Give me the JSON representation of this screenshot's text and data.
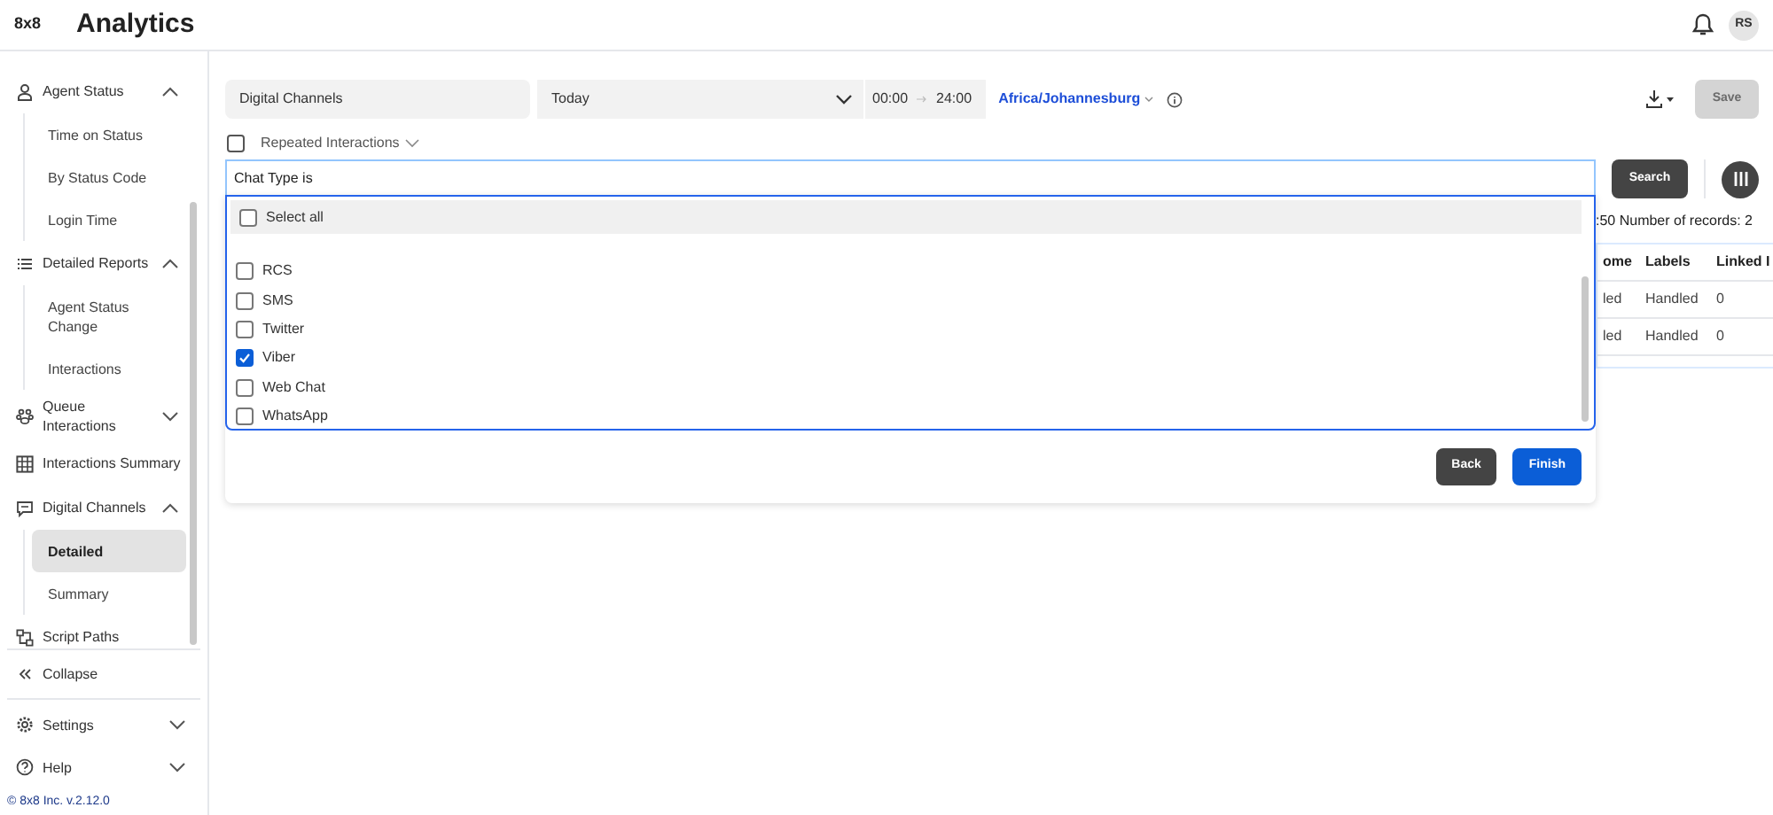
{
  "header": {
    "logo": "8x8",
    "title": "Analytics",
    "avatar": "RS"
  },
  "sidebar": {
    "items": [
      {
        "label": "Agent Status",
        "expanded": true,
        "children": [
          {
            "label": "Time on Status",
            "selected": false
          },
          {
            "label": "By Status Code",
            "selected": false
          },
          {
            "label": "Login Time",
            "selected": false
          }
        ]
      },
      {
        "label": "Detailed Reports",
        "expanded": true,
        "children": [
          {
            "label": "Agent Status Change",
            "selected": false
          },
          {
            "label": "Interactions",
            "selected": false
          }
        ]
      },
      {
        "label": "Queue Interactions",
        "expanded": false
      },
      {
        "label": "Interactions Summary"
      },
      {
        "label": "Digital Channels",
        "expanded": true,
        "children": [
          {
            "label": "Detailed",
            "selected": true
          },
          {
            "label": "Summary",
            "selected": false
          }
        ]
      },
      {
        "label": "Script Paths"
      }
    ],
    "collapse": "Collapse",
    "footer_items": [
      {
        "label": "Settings",
        "expanded": false
      },
      {
        "label": "Help",
        "expanded": false
      }
    ],
    "version": "© 8x8 Inc. v.2.12.0"
  },
  "filters": {
    "report": "Digital Channels",
    "period": "Today",
    "time_from": "00:00",
    "time_to": "24:00",
    "timezone": "Africa/Johannesburg",
    "save": "Save",
    "save_disabled": true
  },
  "repeated": {
    "label": "Repeated Interactions",
    "checked": false
  },
  "query": {
    "value": "Chat Type is",
    "search": "Search"
  },
  "background": {
    "records": ":50  Number of records: 2",
    "columns": [
      "ome",
      "Labels",
      "Linked I"
    ],
    "rows": [
      [
        "led",
        "Handled",
        "0"
      ],
      [
        "led",
        "Handled",
        "0"
      ]
    ]
  },
  "dropdown": {
    "select_all": {
      "label": "Select all",
      "checked": false
    },
    "options": [
      {
        "label": "RCS",
        "checked": false
      },
      {
        "label": "SMS",
        "checked": false
      },
      {
        "label": "Twitter",
        "checked": false
      },
      {
        "label": "Viber",
        "checked": true
      },
      {
        "label": "Web Chat",
        "checked": false
      },
      {
        "label": "WhatsApp",
        "checked": false
      }
    ],
    "buttons": [
      {
        "label": "Back",
        "kind": "secondary"
      },
      {
        "label": "Finish",
        "kind": "primary"
      }
    ]
  }
}
